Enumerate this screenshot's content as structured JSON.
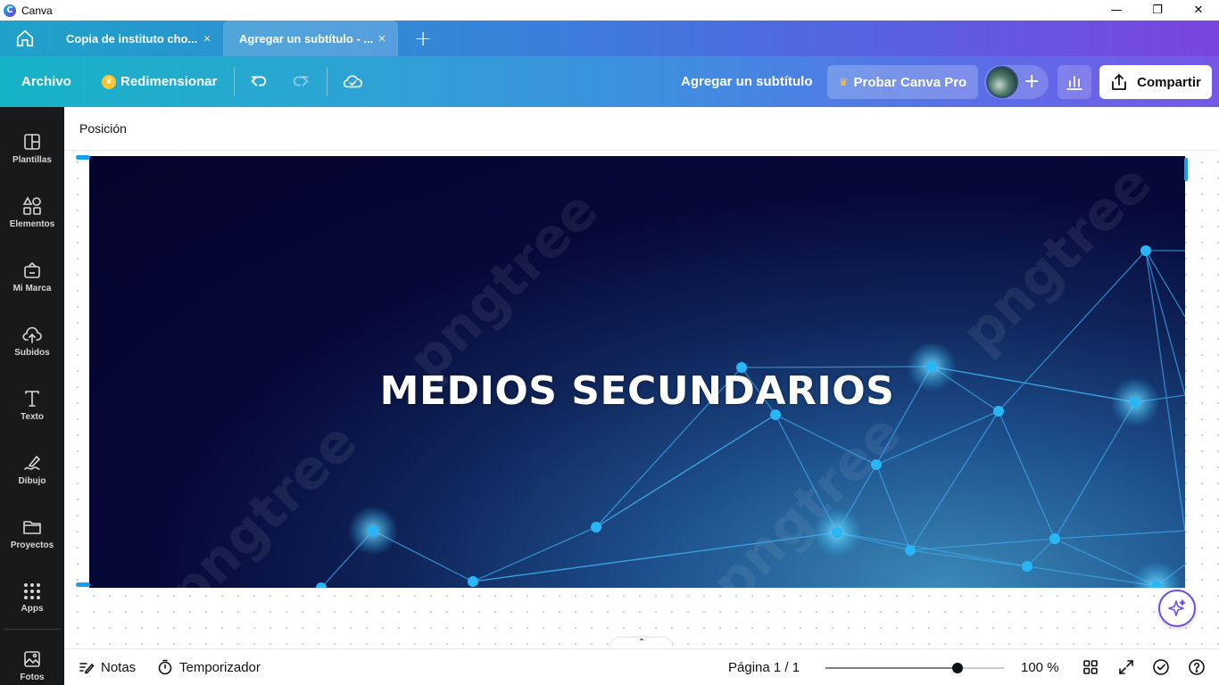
{
  "window": {
    "app_title": "Canva",
    "minimize": "—",
    "maximize": "❐",
    "close": "✕"
  },
  "tabs": [
    {
      "label": "Copia de instituto cho...",
      "close": "×"
    },
    {
      "label": "Agregar un subtítulo - ...",
      "close": "×"
    }
  ],
  "new_tab": "+",
  "toolbar": {
    "file_label": "Archivo",
    "resize_label": "Redimensionar",
    "design_title": "Agregar un subtítulo",
    "try_pro_label": "Probar Canva Pro",
    "share_label": "Compartir",
    "add_collaborator": "+"
  },
  "sidebar": {
    "items": [
      {
        "label": "Plantillas",
        "icon": "templates-icon"
      },
      {
        "label": "Elementos",
        "icon": "elements-icon"
      },
      {
        "label": "Mi Marca",
        "icon": "brand-icon"
      },
      {
        "label": "Subidos",
        "icon": "uploads-icon"
      },
      {
        "label": "Texto",
        "icon": "text-icon"
      },
      {
        "label": "Dibujo",
        "icon": "draw-icon"
      },
      {
        "label": "Proyectos",
        "icon": "folder-icon"
      },
      {
        "label": "Apps",
        "icon": "apps-icon"
      },
      {
        "label": "Fotos",
        "icon": "photos-icon"
      }
    ]
  },
  "context_bar": {
    "position_label": "Posición"
  },
  "canvas": {
    "headline": "MEDIOS SECUNDARIOS",
    "watermark_text": "pngtree",
    "colors": {
      "bg_dark": "#05042c",
      "bg_glow": "#3a8ab8",
      "node": "#29b6f6",
      "line": "#3da6e6"
    }
  },
  "footer": {
    "notes_label": "Notas",
    "timer_label": "Temporizador",
    "page_label": "Página 1 / 1",
    "zoom_value": "100 %",
    "zoom_fraction": 0.74
  },
  "theme": {
    "accent_purple": "#7d2ae8",
    "accent_teal": "#00c4cc",
    "selection_blue": "#139ef0"
  }
}
